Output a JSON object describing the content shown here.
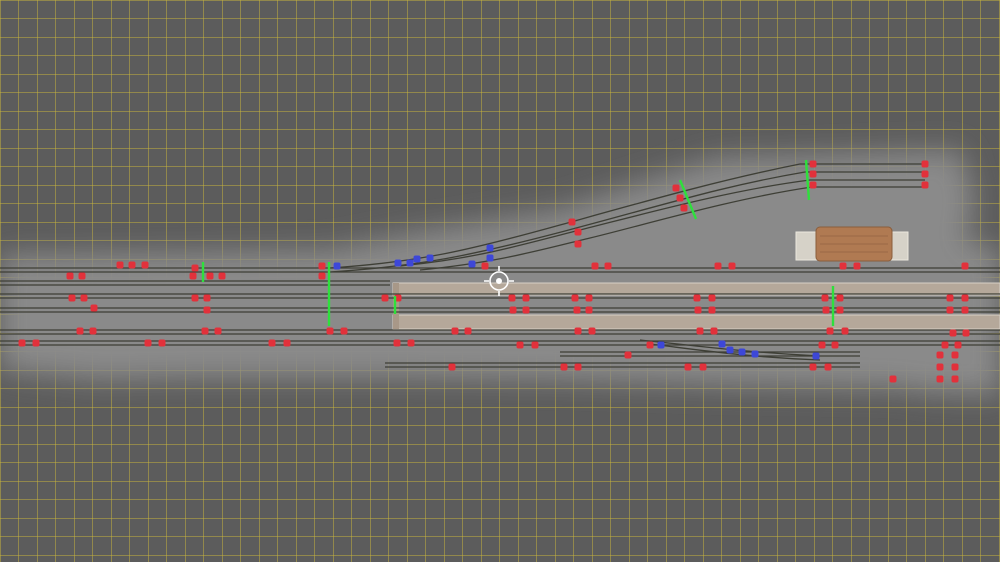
{
  "scene": {
    "description_free": true,
    "colors": {
      "background_grid_fill": "#5c5c5c",
      "grid_line": "#c8b43c",
      "ground": "#8a8a8a",
      "ballast": "#7c7c74",
      "rail": "#3e3f36",
      "platform": "#b5a89a",
      "platform_edge": "#e8e0d8",
      "track_marker_red": "#e2313b",
      "track_marker_blue": "#3d47d8",
      "signal_green": "#2ee03c",
      "building_roof": "#b07a52"
    },
    "markers": {
      "red": "track-marker-red",
      "blue": "track-marker-blue",
      "green": "signal-link-green"
    },
    "cursor": "camera-target-icon"
  }
}
